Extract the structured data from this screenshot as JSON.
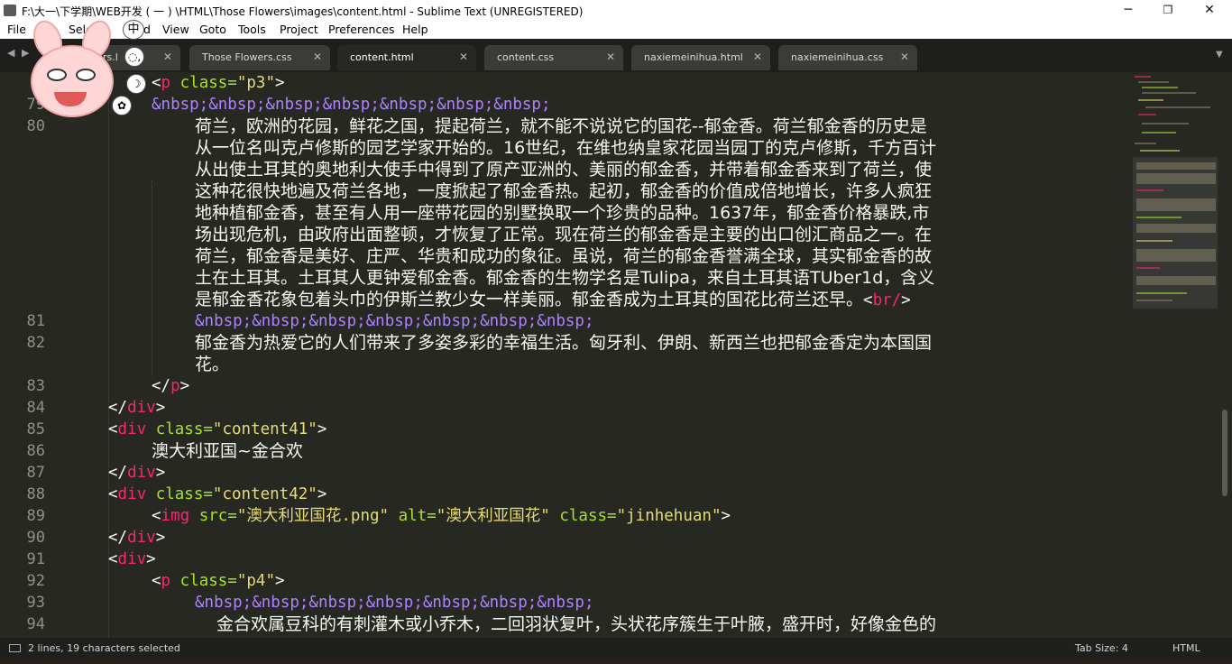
{
  "window": {
    "title": "F:\\大一\\下学期\\WEB开发 ( 一 ) \\HTML\\Those Flowers\\images\\content.html - Sublime Text (UNREGISTERED)",
    "minimize": "─",
    "maximize": "❐",
    "close": "✕"
  },
  "menu": [
    {
      "label": "File"
    },
    {
      "label": "Sele"
    },
    {
      "label": "d"
    },
    {
      "label": "View"
    },
    {
      "label": "Goto"
    },
    {
      "label": "Tools"
    },
    {
      "label": "Project"
    },
    {
      "label": "Preferences"
    },
    {
      "label": "Help"
    }
  ],
  "tabs": [
    {
      "label": "rs.l",
      "close": "✕"
    },
    {
      "label": "Those Flowers.css",
      "close": "✕"
    },
    {
      "label": "content.html",
      "close": "✕",
      "active": true
    },
    {
      "label": "content.css",
      "close": "✕"
    },
    {
      "label": "naxiemeinihua.html",
      "close": "✕"
    },
    {
      "label": "naxiemeinihua.css",
      "close": "✕"
    }
  ],
  "nav": {
    "left": "◀",
    "right": "▶",
    "dropdown": "▼"
  },
  "code": {
    "line_numbers": [
      "7",
      "79",
      "80",
      "81",
      "82",
      "83",
      "84",
      "85",
      "86",
      "87",
      "88",
      "89",
      "90",
      "91",
      "92",
      "93",
      "94"
    ],
    "l78": {
      "lt": "<",
      "tag": "p",
      "attr": " class=",
      "val": "\"p3\"",
      "gt": ">"
    },
    "l79": "&nbsp;&nbsp;&nbsp;&nbsp;&nbsp;&nbsp;&nbsp;",
    "l80": [
      "荷兰，欧洲的花园，鲜花之国，提起荷兰，就不能不说说它的国花--郁金香。荷兰郁金香的历史是",
      "从一位名叫克卢修斯的园艺学家开始的。16世纪，在维也纳皇家花园当园丁的克卢修斯，千方百计",
      "从出使土耳其的奥地利大使手中得到了原产亚洲的、美丽的郁金香，并带着郁金香来到了荷兰，使",
      "这种花很快地遍及荷兰各地，一度掀起了郁金香热。起初，郁金香的价值成倍地增长，许多人疯狂",
      "地种植郁金香，甚至有人用一座带花园的别墅换取一个珍贵的品种。1637年，郁金香价格暴跌,市",
      "场出现危机，由政府出面整顿，才恢复了正常。现在荷兰的郁金香是主要的出口创汇商品之一。在",
      "荷兰，郁金香是美好、庄严、华贵和成功的象征。虽说，荷兰的郁金香誉满全球，其实郁金香的故",
      "土在土耳其。土耳其人更钟爱郁金香。郁金香的生物学名是Tulipa，来自土耳其语TUber1d，含义",
      "是郁金香花象包着头巾的伊斯兰教少女一样美丽。郁金香成为土耳其的国花比荷兰还早。"
    ],
    "l80_br": {
      "lt": "<",
      "tag": "br/",
      "gt": ">"
    },
    "l81": "&nbsp;&nbsp;&nbsp;&nbsp;&nbsp;&nbsp;&nbsp;",
    "l82": [
      "郁金香为热爱它的人们带来了多姿多彩的幸福生活。匈牙利、伊朗、新西兰也把郁金香定为本国国",
      "花。"
    ],
    "l83": {
      "lt": "</",
      "tag": "p",
      "gt": ">"
    },
    "l84": {
      "lt": "</",
      "tag": "div",
      "gt": ">"
    },
    "l85": {
      "lt": "<",
      "tag": "div",
      "attr": " class=",
      "val": "\"content41\"",
      "gt": ">"
    },
    "l86": "澳大利亚国~金合欢",
    "l87": {
      "lt": "</",
      "tag": "div",
      "gt": ">"
    },
    "l88": {
      "lt": "<",
      "tag": "div",
      "attr": " class=",
      "val": "\"content42\"",
      "gt": ">"
    },
    "l89": {
      "lt": "<",
      "tag": "img",
      "a1": " src=",
      "v1": "\"澳大利亚国花.png\"",
      "a2": " alt=",
      "v2": "\"澳大利亚国花\"",
      "a3": " class=",
      "v3": "\"jinhehuan\"",
      "gt": ">"
    },
    "l90": {
      "lt": "</",
      "tag": "div",
      "gt": ">"
    },
    "l91": {
      "lt": "<",
      "tag": "div",
      "gt": ">"
    },
    "l92": {
      "lt": "<",
      "tag": "p",
      "attr": " class=",
      "val": "\"p4\"",
      "gt": ">"
    },
    "l93": "&nbsp;&nbsp;&nbsp;&nbsp;&nbsp;&nbsp;&nbsp;",
    "l94": "金合欢属豆科的有刺灌木或小乔木，二回羽状复叶，头状花序簇生于叶腋，盛开时，好像金色的"
  },
  "status": {
    "selection": "2 lines, 19 characters selected",
    "tab_size": "Tab Size: 4",
    "syntax": "HTML"
  },
  "ime": {
    "mode": "中",
    "b1": "◌,",
    "b2": "☽",
    "b3": "✿"
  },
  "colors": {
    "background": "#272822",
    "tag": "#f92672",
    "attribute": "#a6e22e",
    "string": "#e6db74",
    "entity": "#ae81ff",
    "text": "#f8f8f2"
  }
}
